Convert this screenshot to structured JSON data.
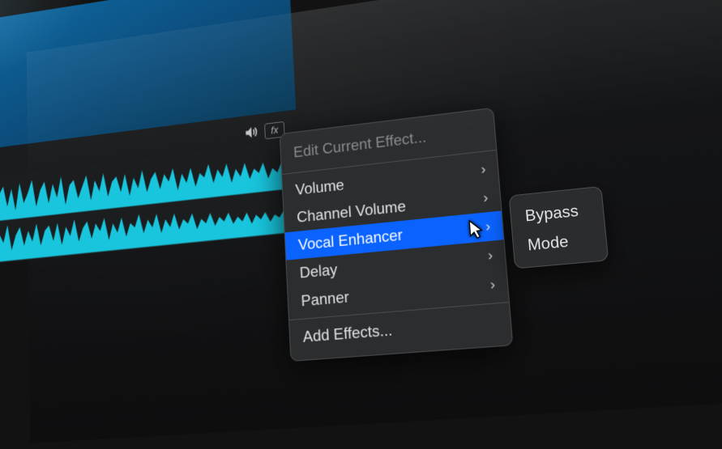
{
  "menu": {
    "header": "Edit Current Effect...",
    "items": [
      {
        "label": "Volume"
      },
      {
        "label": "Channel Volume"
      },
      {
        "label": "Vocal Enhancer"
      },
      {
        "label": "Delay"
      },
      {
        "label": "Panner"
      }
    ],
    "add": "Add Effects..."
  },
  "submenu": {
    "items": [
      {
        "label": "Bypass"
      },
      {
        "label": "Mode"
      }
    ]
  },
  "icons": {
    "audio": "audio-output-icon",
    "fx": "fx"
  }
}
